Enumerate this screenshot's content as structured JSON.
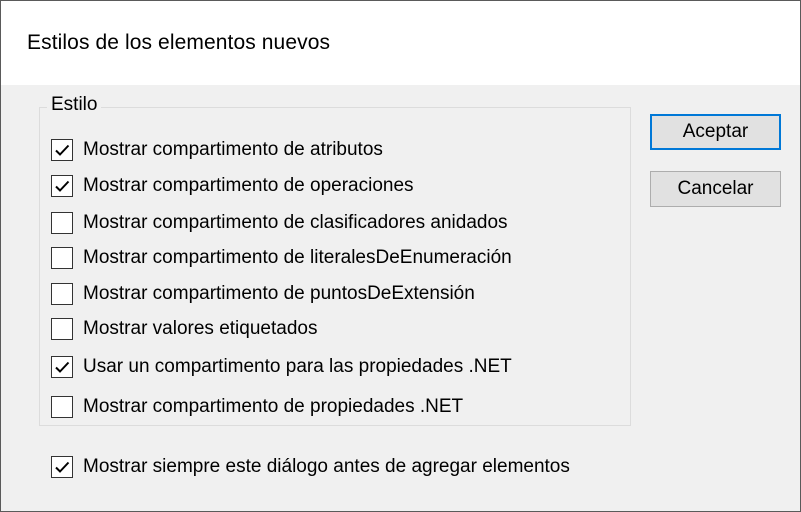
{
  "dialog": {
    "title": "Estilos de los elementos nuevos",
    "group_label": "Estilo",
    "options": [
      {
        "label": "Mostrar compartimento de atributos",
        "checked": true
      },
      {
        "label": "Mostrar compartimento de operaciones",
        "checked": true
      },
      {
        "label": "Mostrar compartimento de clasificadores anidados",
        "checked": false
      },
      {
        "label": "Mostrar compartimento de literalesDeEnumeración",
        "checked": false
      },
      {
        "label": "Mostrar compartimento de puntosDeExtensión",
        "checked": false
      },
      {
        "label": "Mostrar valores etiquetados",
        "checked": false
      },
      {
        "label": "Usar un compartimento para las propiedades .NET",
        "checked": true
      },
      {
        "label": "Mostrar compartimento de propiedades .NET",
        "checked": false
      }
    ],
    "always_show": {
      "label": "Mostrar siempre este diálogo antes de agregar elementos",
      "checked": true
    },
    "ok_label": "Aceptar",
    "cancel_label": "Cancelar"
  },
  "colors": {
    "dialog_bg": "#f0f0f0",
    "default_button_border": "#0078d7"
  }
}
